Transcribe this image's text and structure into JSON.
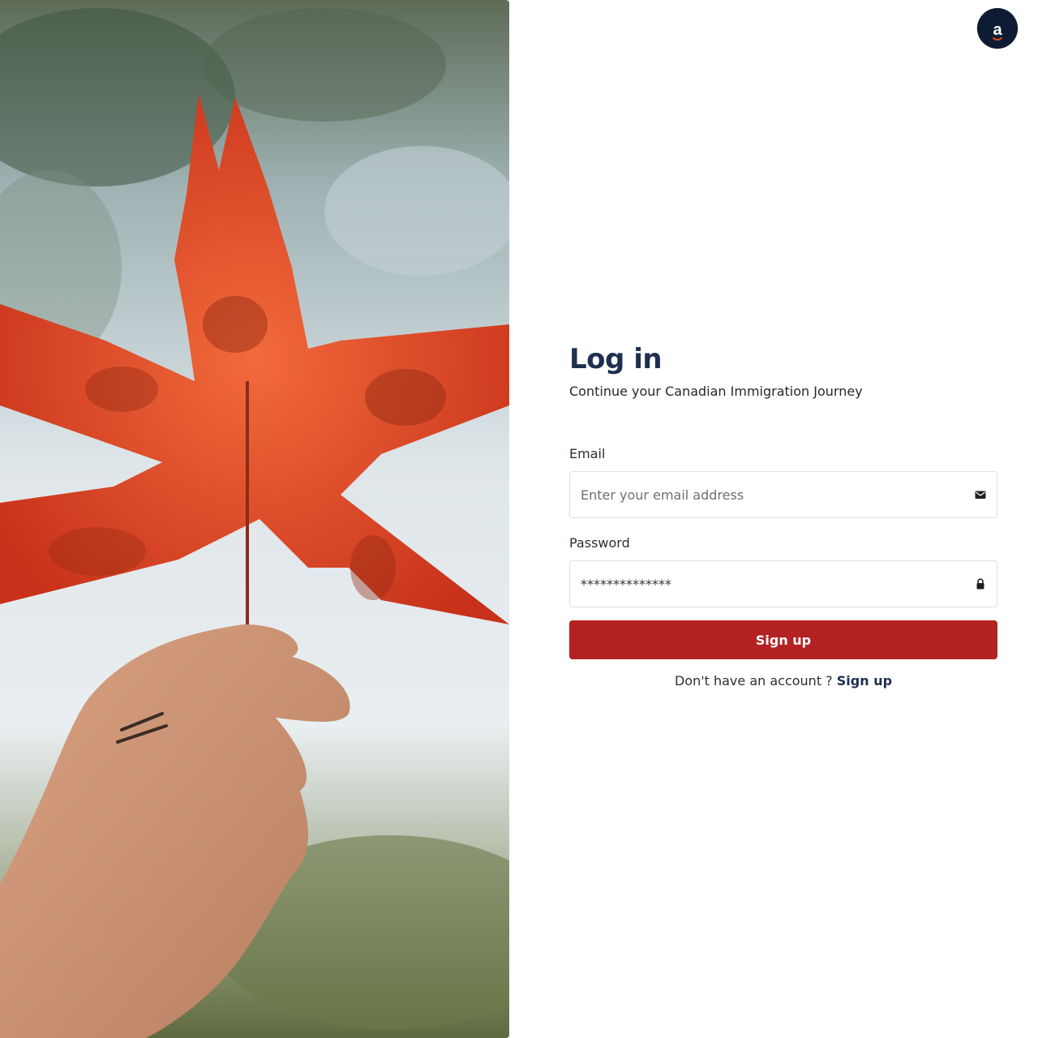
{
  "hero": {
    "image_icon": "hand-holding-maple-leaf-photo"
  },
  "header": {
    "avatar_letter": "a",
    "avatar_icon": "user-avatar-icon"
  },
  "login": {
    "title": "Log in",
    "subtitle": "Continue your Canadian Immigration Journey",
    "email": {
      "label": "Email",
      "placeholder": "Enter your email address",
      "value": "",
      "icon": "envelope-icon"
    },
    "password": {
      "label": "Password",
      "value": "**************",
      "icon": "lock-icon"
    },
    "submit_label": "Sign up",
    "no_account_text": "Don't have an account ?",
    "signup_link_label": "Sign up"
  },
  "colors": {
    "primary_navy": "#1e2f4f",
    "button_red": "#b22222",
    "avatar_bg": "#0e1c33",
    "leaf_red": "#e0481f"
  }
}
